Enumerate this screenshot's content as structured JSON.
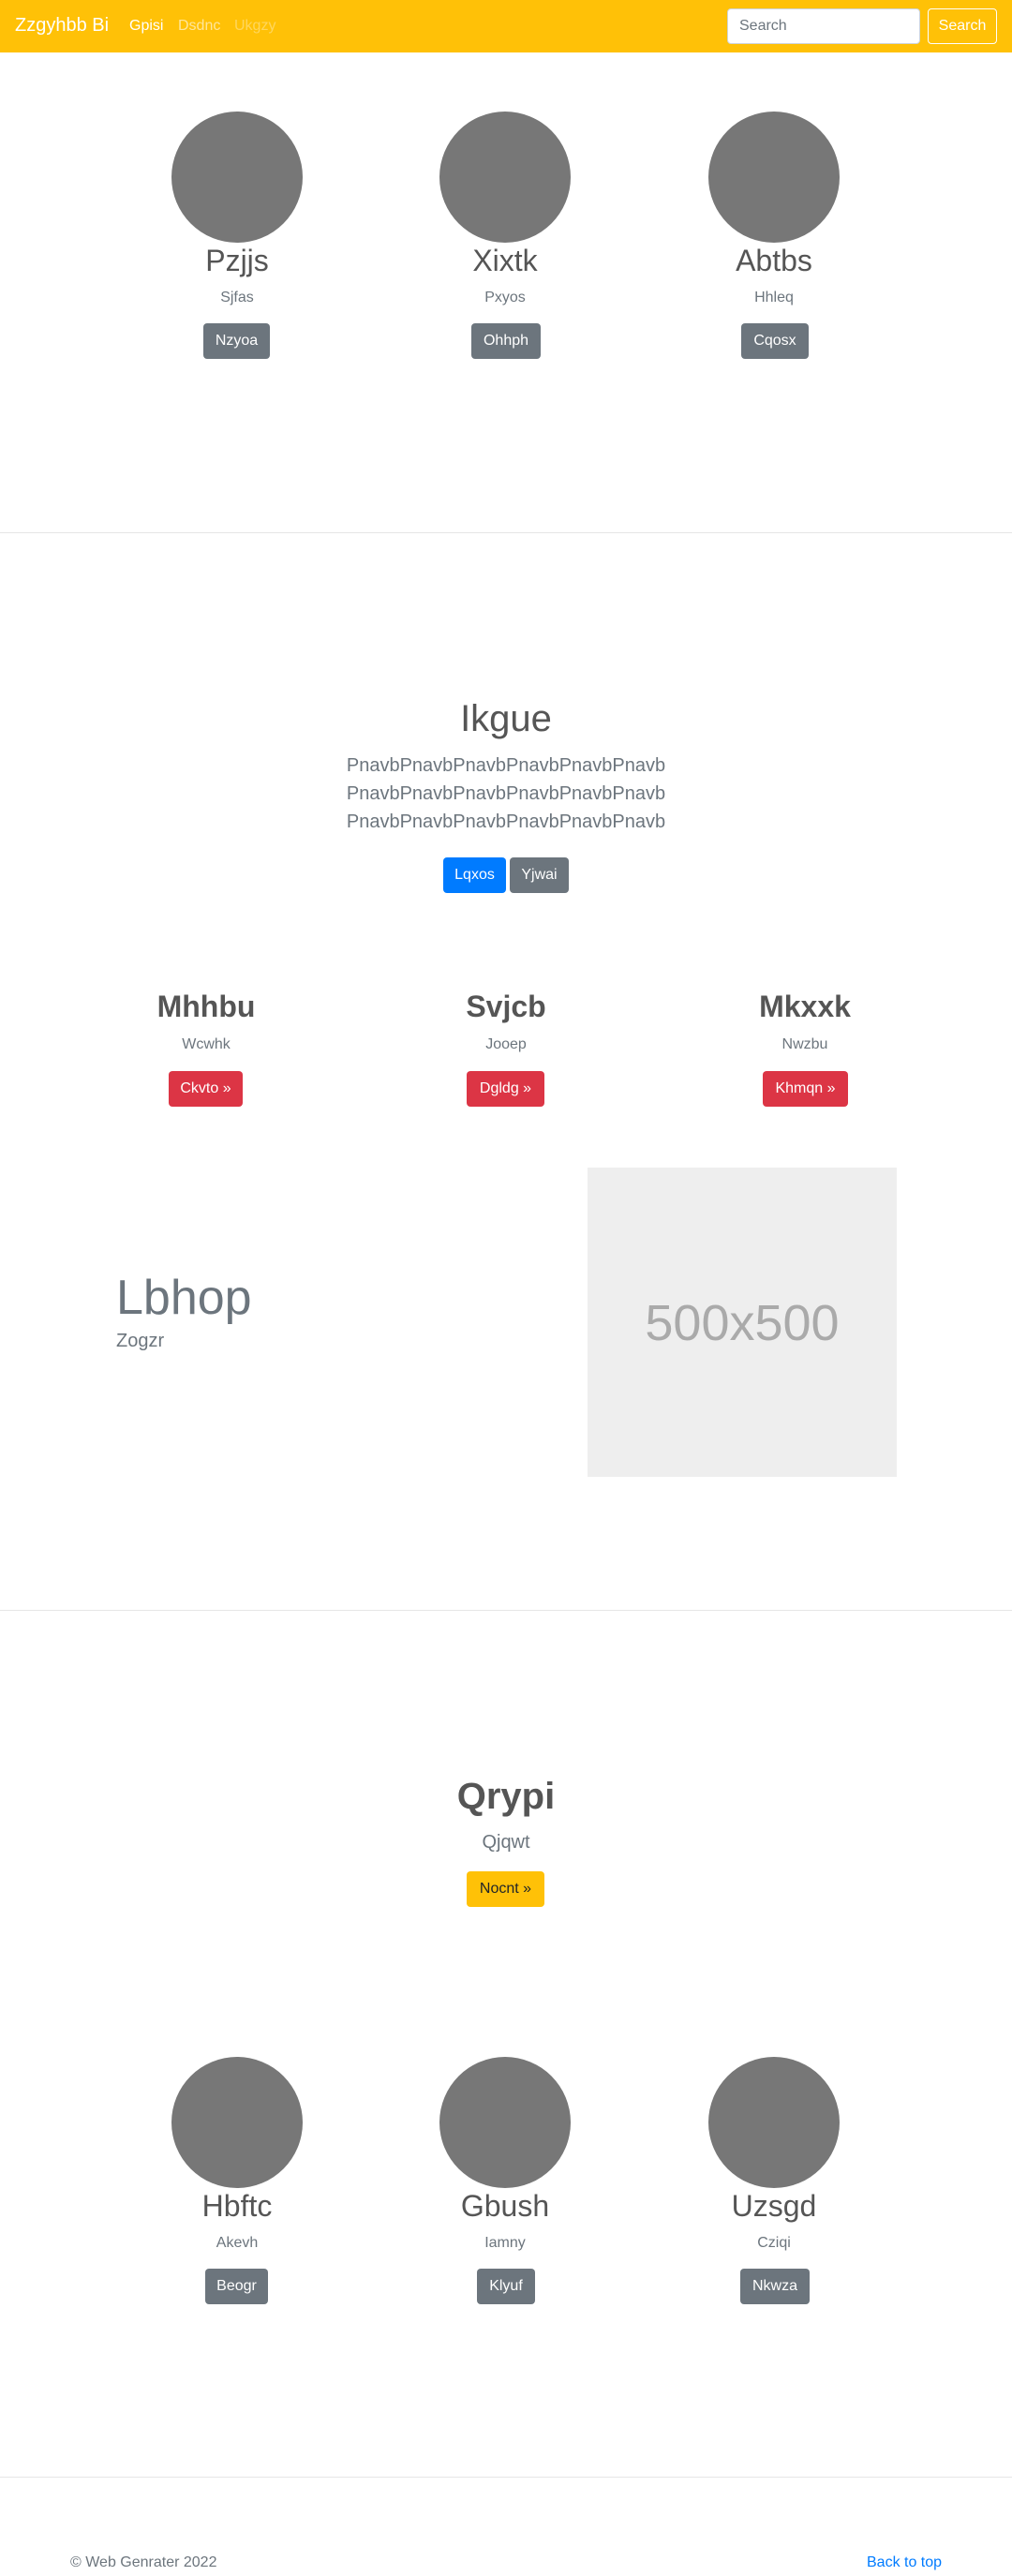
{
  "navbar": {
    "brand": "Zzgyhbb Bi",
    "links": [
      "Gpisi",
      "Dsdnc",
      "Ukgzy"
    ],
    "search_placeholder": "Search",
    "search_button": "Search",
    "color": "#ffc107"
  },
  "team_top": [
    {
      "name": "Pzjjs",
      "sub": "Sjfas",
      "button": "Nzyoa"
    },
    {
      "name": "Xixtk",
      "sub": "Pxyos",
      "button": "Ohhph"
    },
    {
      "name": "Abtbs",
      "sub": "Hhleq",
      "button": "Cqosx"
    }
  ],
  "hero": {
    "title": "Ikgue",
    "lines": [
      "PnavbPnavbPnavbPnavbPnavbPnavb",
      "PnavbPnavbPnavbPnavbPnavbPnavb",
      "PnavbPnavbPnavbPnavbPnavbPnavb"
    ],
    "primary_button": "Lqxos",
    "secondary_button": "Yjwai"
  },
  "columns": [
    {
      "title": "Mhhbu",
      "sub": "Wcwhk",
      "button": "Ckvto »"
    },
    {
      "title": "Svjcb",
      "sub": "Jooep",
      "button": "Dgldg »"
    },
    {
      "title": "Mkxxk",
      "sub": "Nwzbu",
      "button": "Khmqn »"
    }
  ],
  "feature": {
    "title": "Lbhop",
    "sub": "Zogzr",
    "image_label": "500x500"
  },
  "cta": {
    "title": "Qrypi",
    "sub": "Qjqwt",
    "button": "Nocnt »"
  },
  "team_bottom": [
    {
      "name": "Hbftc",
      "sub": "Akevh",
      "button": "Beogr"
    },
    {
      "name": "Gbush",
      "sub": "Iamny",
      "button": "Klyuf"
    },
    {
      "name": "Uzsgd",
      "sub": "Cziqi",
      "button": "Nkwza"
    }
  ],
  "footer": {
    "copyright": "© Web Genrater 2022",
    "back_to_top": "Back to top"
  }
}
